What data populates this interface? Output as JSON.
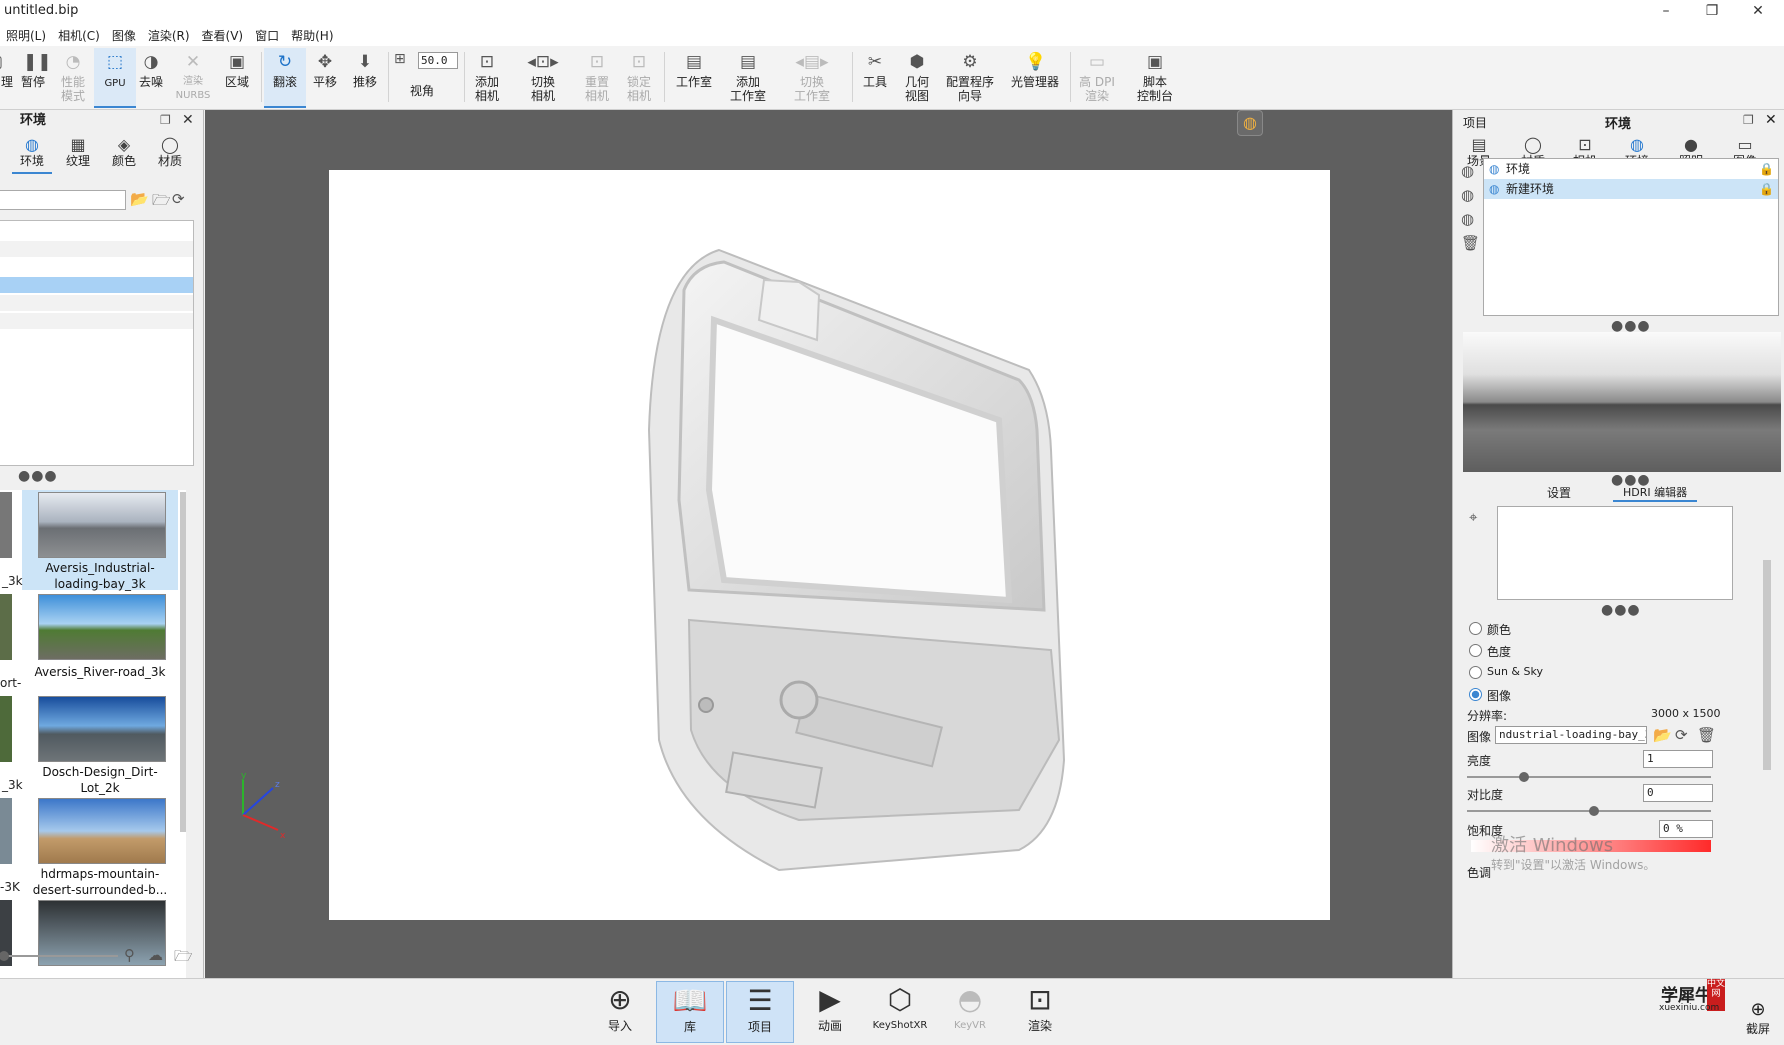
{
  "window": {
    "title": "untitled.bip",
    "minimize": "–",
    "maximize": "❐",
    "close": "✕"
  },
  "menu": [
    "照明(L)",
    "相机(C)",
    "图像",
    "渲染(R)",
    "查看(V)",
    "窗口",
    "帮助(H)"
  ],
  "toolbar": {
    "partial_label": "理",
    "pause": "暂停",
    "perf_mode": "性能\n模式",
    "gpu": "GPU",
    "denoise": "去噪",
    "render_nurbs": "渲染\nNURBS",
    "region": "区域",
    "tumble": "翻滚",
    "pan": "平移",
    "dolly": "推移",
    "fov_label": "视角",
    "fov_value": "50.0",
    "add_camera": "添加\n相机",
    "switch_camera": "切换\n相机",
    "reset_camera": "重置\n相机",
    "lock_camera": "锁定\n相机",
    "studio": "工作室",
    "add_studio": "添加\n工作室",
    "switch_studio": "切换\n工作室",
    "tools": "工具",
    "geometry_view": "几何\n视图",
    "config_wizard": "配置程序\n向导",
    "light_manager": "光管理器",
    "hidpi_render": "高 DPI\n渲染",
    "script_console": "脚本\n控制台"
  },
  "left_panel": {
    "title": "环境",
    "tabs": [
      "环境",
      "纹理",
      "颜色",
      "材质"
    ],
    "thumbnails": [
      {
        "label": "Aversis_Industrial-\nloading-bay_3k",
        "selected": true
      },
      {
        "label": "Aversis_River-road_3k",
        "selected": false
      },
      {
        "label": "Dosch-Design_Dirt-\nLot_2k",
        "selected": false
      },
      {
        "label": "hdrmaps-mountain-\ndesert-surrounded-b...",
        "selected": false
      },
      {
        "label": "",
        "selected": false
      }
    ],
    "clipped_labels": [
      "_3k",
      "ort-",
      "_3k",
      "-3K"
    ]
  },
  "right_panel": {
    "section": "项目",
    "title": "环境",
    "tabs": [
      "场景",
      "材质",
      "相机",
      "环境",
      "照明",
      "图像"
    ],
    "environments": [
      {
        "name": "环境",
        "selected": false
      },
      {
        "name": "新建环境",
        "selected": true
      }
    ],
    "subtabs": [
      "设置",
      "HDRI 编辑器"
    ],
    "bg_options": [
      {
        "label": "颜色",
        "checked": false
      },
      {
        "label": "色度",
        "checked": false
      },
      {
        "label": "Sun & Sky",
        "checked": false
      },
      {
        "label": "图像",
        "checked": true
      }
    ],
    "resolution_label": "分辨率:",
    "resolution_value": "3000 x 1500",
    "image_label": "图像",
    "image_file": "ndustrial-loading-bay_3k.hdz",
    "brightness_label": "亮度",
    "brightness_value": "1",
    "contrast_label": "对比度",
    "contrast_value": "0",
    "saturation_label": "饱和度",
    "saturation_value": "0 %",
    "hue_partial": "色调"
  },
  "bottom_bar": [
    {
      "label": "导入",
      "icon": "import-icon",
      "active": false,
      "disabled": false
    },
    {
      "label": "库",
      "icon": "library-icon",
      "active": true,
      "disabled": false
    },
    {
      "label": "项目",
      "icon": "project-icon",
      "active": true,
      "disabled": false
    },
    {
      "label": "动画",
      "icon": "animation-icon",
      "active": false,
      "disabled": false
    },
    {
      "label": "KeyShotXR",
      "icon": "keyshotxr-icon",
      "active": false,
      "disabled": false
    },
    {
      "label": "KeyVR",
      "icon": "keyvr-icon",
      "active": false,
      "disabled": true
    },
    {
      "label": "渲染",
      "icon": "render-icon",
      "active": false,
      "disabled": false
    }
  ],
  "screenshot_button": "截屏",
  "watermark": {
    "line1": "激活 Windows",
    "line2": "转到\"设置\"以激活 Windows。"
  },
  "site_logo": {
    "name": "学犀牛",
    "url": "xuexiniu.com",
    "badge": "中文网"
  },
  "axes": {
    "x": "x",
    "y": "y",
    "z": "z"
  },
  "colors": {
    "accent": "#3b86d1",
    "viewport_bg": "#5f5f5f",
    "selection": "#cce4f7"
  }
}
